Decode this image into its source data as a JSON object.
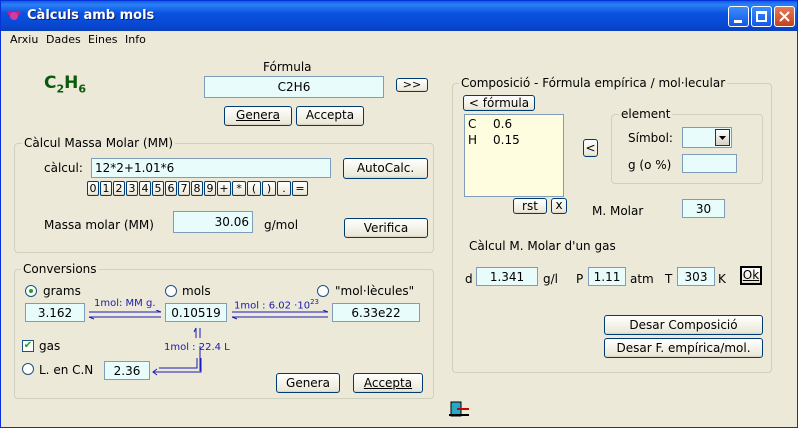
{
  "window": {
    "title": "Càlculs amb mols"
  },
  "menu": [
    "Arxiu",
    "Dades",
    "Eines",
    "Info"
  ],
  "formula": {
    "big_main": "C",
    "big_sub1": "2",
    "big_h": "H",
    "big_sub2": "6",
    "label": "Fórmula",
    "value": "C2H6",
    "next_btn": ">>",
    "generate_btn": "Genera",
    "accept_btn": "Accepta"
  },
  "molar_mass": {
    "legend": "Càlcul Massa Molar (MM)",
    "calc_label": "càlcul:",
    "calc_value": "12*2+1.01*6",
    "autocalc_btn": "AutoCalc.",
    "keys": [
      "0",
      "1",
      "2",
      "3",
      "4",
      "5",
      "6",
      "7",
      "8",
      "9",
      "+",
      "*",
      "(",
      ")",
      ".",
      "="
    ],
    "mm_label": "Massa molar (MM)",
    "mm_value": "30.06",
    "mm_unit": "g/mol",
    "verify_btn": "Verifica"
  },
  "conversions": {
    "legend": "Conversions",
    "grams_label": "grams",
    "mols_label": "mols",
    "molecules_label": "\"mol·lècules\"",
    "grams_value": "3.162",
    "mols_value": "0.10519",
    "molecules_value": "6.33e22",
    "arrow1_label": "1mol: MM g.",
    "arrow2_label": "1mol : 6.02 ·10",
    "arrow2_exp": "23",
    "arrow3_label": "1mol : 22.4 L",
    "gas_label": "gas",
    "liters_label": "L. en C.N",
    "liters_value": "2.36",
    "generate_btn": "Genera",
    "accept_btn": "Accepta"
  },
  "composition": {
    "legend": "Composició - Fórmula empírica / mol·lecular",
    "formula_btn": "< fórmula",
    "rows": [
      {
        "el": "C",
        "val": "0.6"
      },
      {
        "el": "H",
        "val": "0.15"
      }
    ],
    "rst_btn": "rst",
    "x_btn": "x",
    "left_btn": "<",
    "element_legend": "element",
    "symbol_label": "Símbol:",
    "grams_pct_label": "g (o %)",
    "mmolar_label": "M. Molar",
    "mmolar_value": "30",
    "gas_title": "Càlcul M. Molar d'un gas",
    "d_label": "d",
    "d_value": "1.341",
    "d_unit": "g/l",
    "p_label": "P",
    "p_value": "1.11",
    "p_unit": "atm",
    "t_label": "T",
    "t_value": "303",
    "t_unit": "K",
    "ok_btn": "Ok",
    "discard_comp_btn": "Desar Composició",
    "discard_emp_btn": "Desar F. empírica/mol."
  },
  "colors": {
    "title_bar": "#0a54e0",
    "field_cyan": "#e8fcfc",
    "formula_green": "#0a5a0a",
    "arrow_blue": "#1a1ab4"
  }
}
